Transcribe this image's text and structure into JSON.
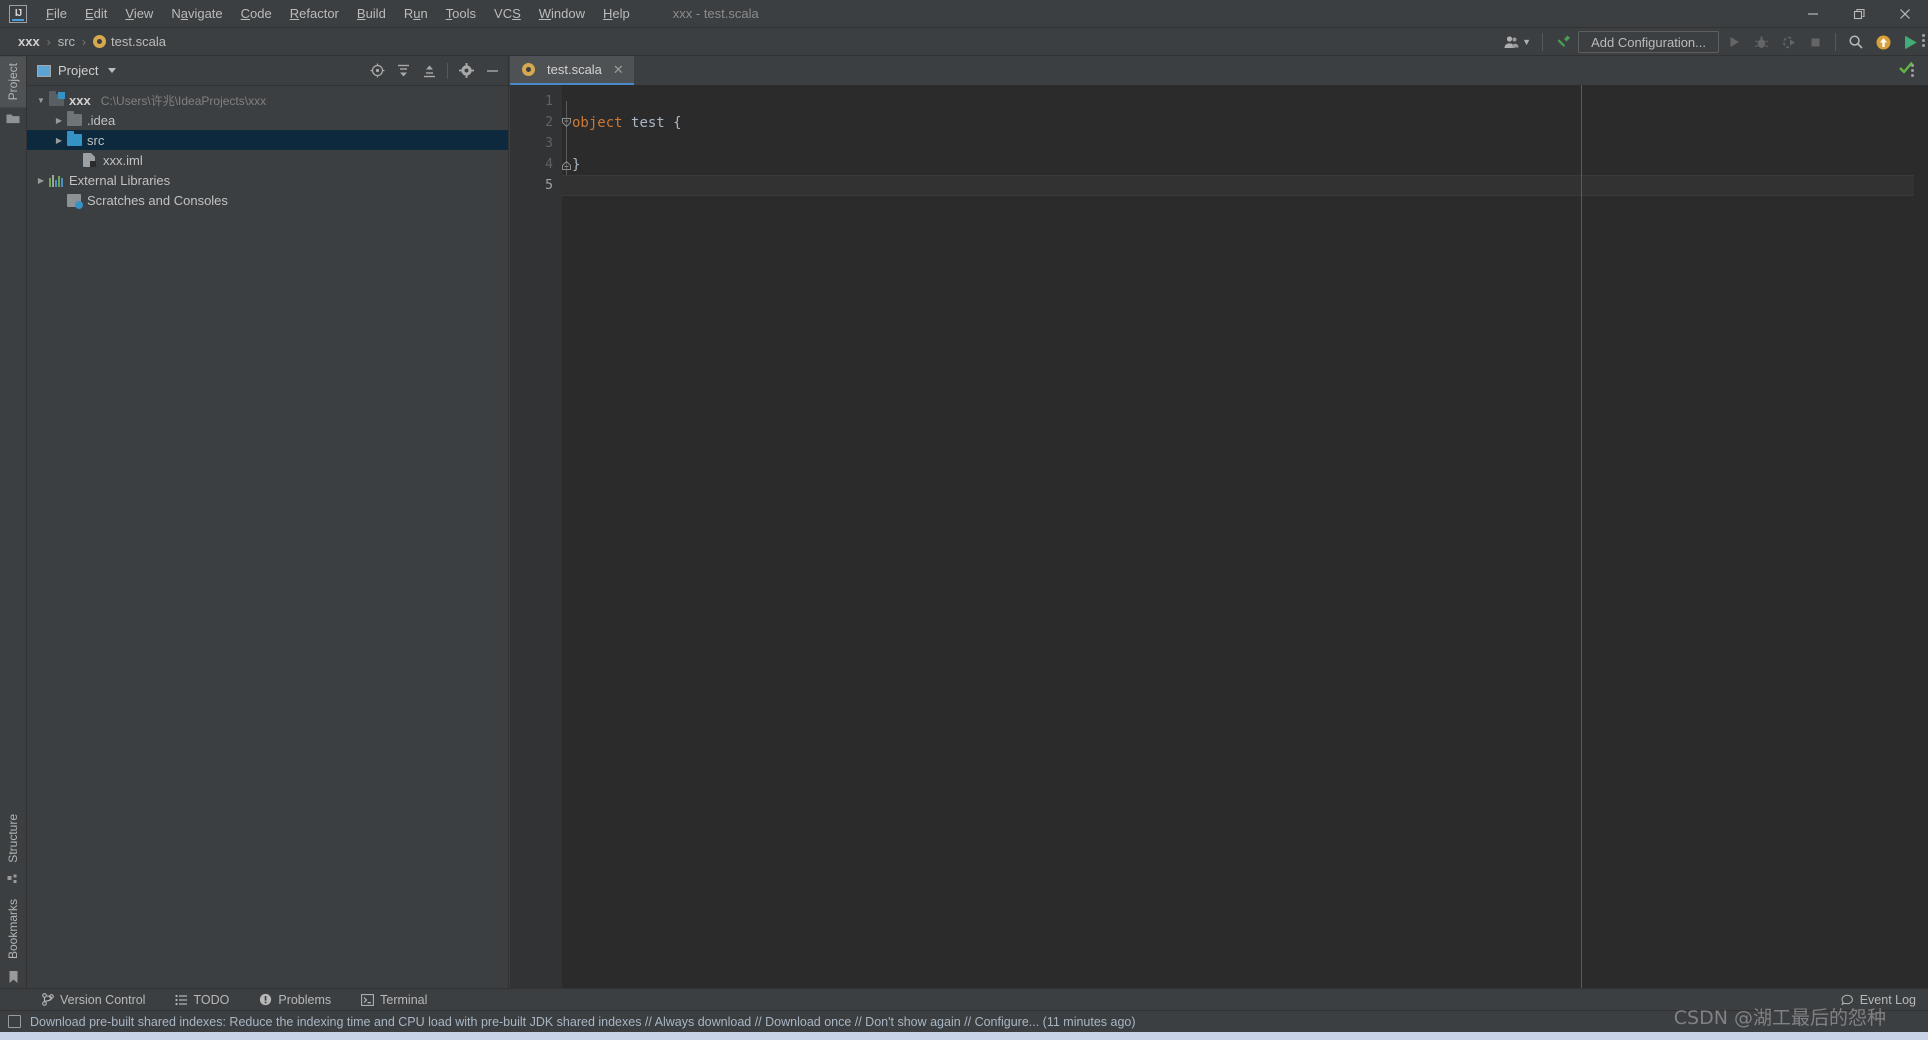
{
  "window": {
    "title": "xxx - test.scala",
    "controls": {
      "minimize": "—",
      "restore": "❐",
      "close": "✕"
    }
  },
  "menubar": {
    "items": [
      {
        "label": "File",
        "mnemonic": "F"
      },
      {
        "label": "Edit",
        "mnemonic": "E"
      },
      {
        "label": "View",
        "mnemonic": "V"
      },
      {
        "label": "Navigate",
        "mnemonic": "a"
      },
      {
        "label": "Code",
        "mnemonic": "C"
      },
      {
        "label": "Refactor",
        "mnemonic": "R"
      },
      {
        "label": "Build",
        "mnemonic": "B"
      },
      {
        "label": "Run",
        "mnemonic": "u"
      },
      {
        "label": "Tools",
        "mnemonic": "T"
      },
      {
        "label": "VCS",
        "mnemonic": "S"
      },
      {
        "label": "Window",
        "mnemonic": "W"
      },
      {
        "label": "Help",
        "mnemonic": "H"
      }
    ]
  },
  "navbar": {
    "breadcrumbs": [
      {
        "label": "xxx",
        "icon": ""
      },
      {
        "label": "src",
        "icon": ""
      },
      {
        "label": "test.scala",
        "icon": "scala-file-icon"
      }
    ],
    "separator": "›",
    "toolbar": {
      "user_icon": "user-account-icon",
      "build_icon": "build-hammer-icon",
      "add_configuration_label": "Add Configuration...",
      "run_icon": "run-icon",
      "debug_icon": "debug-icon",
      "run_coverage_icon": "run-with-coverage-icon",
      "stop_icon": "stop-icon",
      "search_icon": "search-everywhere-icon",
      "update_icon": "update-project-icon",
      "features_icon": "ide-features-trainer-icon"
    }
  },
  "stripe": {
    "top": [
      {
        "label": "Project",
        "active": true
      }
    ],
    "bottom": [
      {
        "label": "Structure"
      },
      {
        "label": "Bookmarks"
      }
    ]
  },
  "project_panel": {
    "title": "Project",
    "tools": [
      {
        "name": "select-opened-file-icon",
        "glyph": "⊕"
      },
      {
        "name": "expand-all-icon",
        "glyph": "≡"
      },
      {
        "name": "collapse-all-icon",
        "glyph": "≡"
      },
      {
        "name": "settings-gear-icon",
        "glyph": "⚙"
      },
      {
        "name": "hide-panel-icon",
        "glyph": "—"
      }
    ],
    "tree": [
      {
        "label": "xxx",
        "path": "C:\\Users\\许兆\\IdeaProjects\\xxx",
        "icon": "module-folder-icon",
        "arrow": "down",
        "indent": 0,
        "bold": true,
        "selected": false
      },
      {
        "label": ".idea",
        "path": "",
        "icon": "folder-icon",
        "arrow": "right",
        "indent": 1,
        "bold": false,
        "selected": false
      },
      {
        "label": "src",
        "path": "",
        "icon": "source-folder-icon",
        "arrow": "right",
        "indent": 1,
        "bold": false,
        "selected": true
      },
      {
        "label": "xxx.iml",
        "path": "",
        "icon": "iml-file-icon",
        "arrow": "none",
        "indent": 2,
        "bold": false,
        "selected": false
      },
      {
        "label": "External Libraries",
        "path": "",
        "icon": "libraries-icon",
        "arrow": "right",
        "indent": 0,
        "bold": false,
        "selected": false
      },
      {
        "label": "Scratches and Consoles",
        "path": "",
        "icon": "scratches-icon",
        "arrow": "none",
        "indent": 1,
        "bold": false,
        "selected": false
      }
    ]
  },
  "editor": {
    "tabs": [
      {
        "label": "test.scala",
        "icon": "scala-file-icon",
        "close": "✕",
        "active": true
      }
    ],
    "line_numbers": [
      "1",
      "2",
      "3",
      "4",
      "5"
    ],
    "current_line": 5,
    "code": [
      {
        "number": "1",
        "tokens": []
      },
      {
        "number": "2",
        "tokens": [
          {
            "t": "object",
            "c": "kw"
          },
          {
            "t": " ",
            "c": "plain"
          },
          {
            "t": "test",
            "c": "cls"
          },
          {
            "t": " {",
            "c": "brace"
          }
        ],
        "fold": "expanded"
      },
      {
        "number": "3",
        "tokens": []
      },
      {
        "number": "4",
        "tokens": [
          {
            "t": "}",
            "c": "brace"
          }
        ],
        "fold": "end"
      },
      {
        "number": "5",
        "tokens": []
      }
    ],
    "inspection_status": "ok-checkmark-icon"
  },
  "tool_window_bar": {
    "left": [
      {
        "label": "Version Control",
        "icon": "version-control-icon"
      },
      {
        "label": "TODO",
        "icon": "todo-icon"
      },
      {
        "label": "Problems",
        "icon": "problems-icon"
      },
      {
        "label": "Terminal",
        "icon": "terminal-icon"
      }
    ],
    "right": [
      {
        "label": "Event Log",
        "icon": "event-log-icon"
      }
    ]
  },
  "statusbar": {
    "icon": "notification-icon",
    "message": "Download pre-built shared indexes: Reduce the indexing time and CPU load with pre-built JDK shared indexes // Always download // Download once // Don't show again // Configure... (11 minutes ago)"
  },
  "watermark": {
    "text": "CSDN @湖工最后的怨种"
  },
  "colors": {
    "panel_bg": "#3c3f41",
    "editor_bg": "#2b2b2b",
    "gutter_bg": "#313335",
    "selection": "#0d293e",
    "tab_active": "#4e5254",
    "accent_blue": "#4a88c7",
    "keyword_orange": "#cc7832",
    "text": "#bbbbbb",
    "status_link": "#a8b6c4",
    "ok_green": "#62b543"
  }
}
